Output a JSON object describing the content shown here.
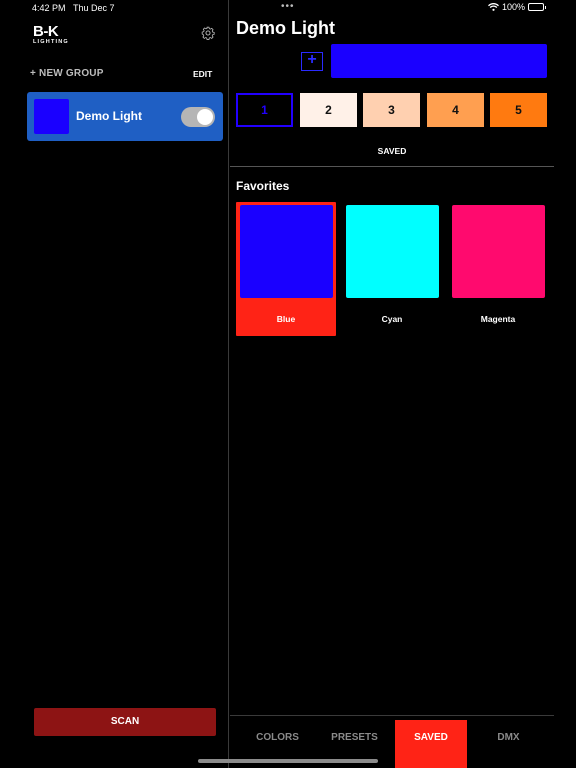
{
  "status": {
    "time": "4:42 PM",
    "date": "Thu Dec 7",
    "battery": "100%",
    "dots": "•••"
  },
  "sidebar": {
    "logo_main": "B-K",
    "logo_sub": "LIGHTING",
    "new_group": "+ NEW GROUP",
    "edit": "EDIT",
    "lights": [
      {
        "name": "Demo Light",
        "color": "#1a00ff",
        "on": true
      }
    ],
    "scan": "SCAN"
  },
  "main": {
    "title": "Demo Light",
    "add_icon": "+",
    "current_color": "#1a00ff",
    "slots": [
      {
        "label": "1",
        "color": "#000000"
      },
      {
        "label": "2",
        "color": "#fff1e8"
      },
      {
        "label": "3",
        "color": "#ffd0b0"
      },
      {
        "label": "4",
        "color": "#ff9f50"
      },
      {
        "label": "5",
        "color": "#ff7a10"
      }
    ],
    "saved_label": "SAVED",
    "favorites_title": "Favorites",
    "favorites": [
      {
        "name": "Blue",
        "color": "#1a00ff",
        "selected": true
      },
      {
        "name": "Cyan",
        "color": "#00ffff",
        "selected": false
      },
      {
        "name": "Magenta",
        "color": "#ff0a6e",
        "selected": false
      }
    ]
  },
  "tabs": [
    {
      "label": "COLORS",
      "active": false
    },
    {
      "label": "PRESETS",
      "active": false
    },
    {
      "label": "SAVED",
      "active": true
    },
    {
      "label": "DMX",
      "active": false
    }
  ],
  "colors": {
    "accent_red": "#ff2316",
    "scan_red": "#8d1414",
    "selection_blue": "#1f5fc4"
  },
  "icons": {
    "settings": "gear-icon",
    "wifi": "wifi-icon",
    "battery": "battery-icon"
  }
}
